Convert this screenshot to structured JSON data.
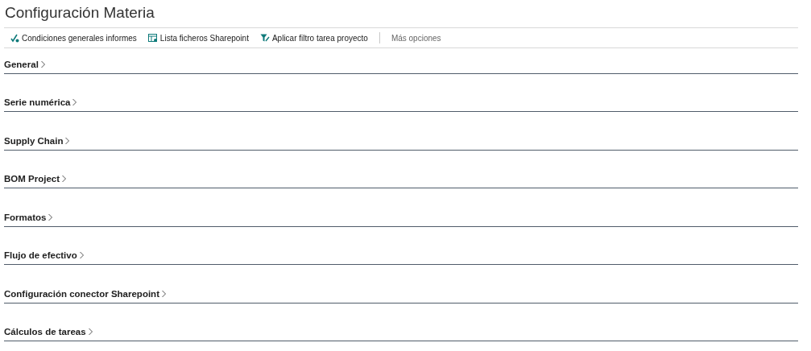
{
  "page": {
    "title": "Configuración Materia"
  },
  "actions": [
    {
      "label": "Condiciones generales informes",
      "kind": "rules"
    },
    {
      "label": "Lista ficheros Sharepoint",
      "kind": "list"
    },
    {
      "label": "Aplicar filtro tarea proyecto",
      "kind": "filter"
    }
  ],
  "more_options": "Más opciones",
  "sections": [
    {
      "title": "General",
      "expanded": false
    },
    {
      "title": "Serie numérica",
      "expanded": false
    },
    {
      "title": "Supply Chain",
      "expanded": false
    },
    {
      "title": "BOM Project",
      "expanded": false
    },
    {
      "title": "Formatos",
      "expanded": false
    },
    {
      "title": "Flujo de efectivo",
      "expanded": false
    },
    {
      "title": "Configuración conector Sharepoint",
      "expanded": false
    },
    {
      "title": "Cálculos de tareas",
      "expanded": false
    }
  ]
}
